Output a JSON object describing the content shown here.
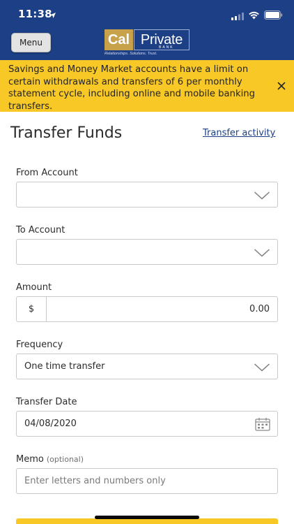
{
  "status_bar": {
    "time": "11:38"
  },
  "header": {
    "menu_label": "Menu",
    "logo": {
      "part1": "Cal",
      "part2": "Private",
      "bank": "BANK",
      "tagline": "Relationships. Solutions. Trust."
    }
  },
  "notice": {
    "text": "Savings and Money Market accounts have a limit on certain withdrawals and transfers of 6 per monthly statement cycle, including online and mobile banking transfers."
  },
  "page": {
    "title": "Transfer Funds",
    "activity_link": "Transfer activity"
  },
  "form": {
    "from_account": {
      "label": "From Account",
      "value": ""
    },
    "to_account": {
      "label": "To Account",
      "value": ""
    },
    "amount": {
      "label": "Amount",
      "prefix": "$",
      "value": "0.00"
    },
    "frequency": {
      "label": "Frequency",
      "value": "One time transfer"
    },
    "transfer_date": {
      "label": "Transfer Date",
      "value": "04/08/2020"
    },
    "memo": {
      "label": "Memo",
      "hint": "(optional)",
      "placeholder": "Enter letters and numbers only"
    }
  },
  "colors": {
    "header_bg": "#1d3f85",
    "notice_bg": "#f8c826",
    "brand_gold": "#c7a24b",
    "link": "#1d3f85"
  },
  "icons": [
    "location-arrow-icon",
    "cellular-signal-icon",
    "wifi-icon",
    "battery-icon",
    "close-icon",
    "chevron-down-icon",
    "calendar-icon"
  ]
}
